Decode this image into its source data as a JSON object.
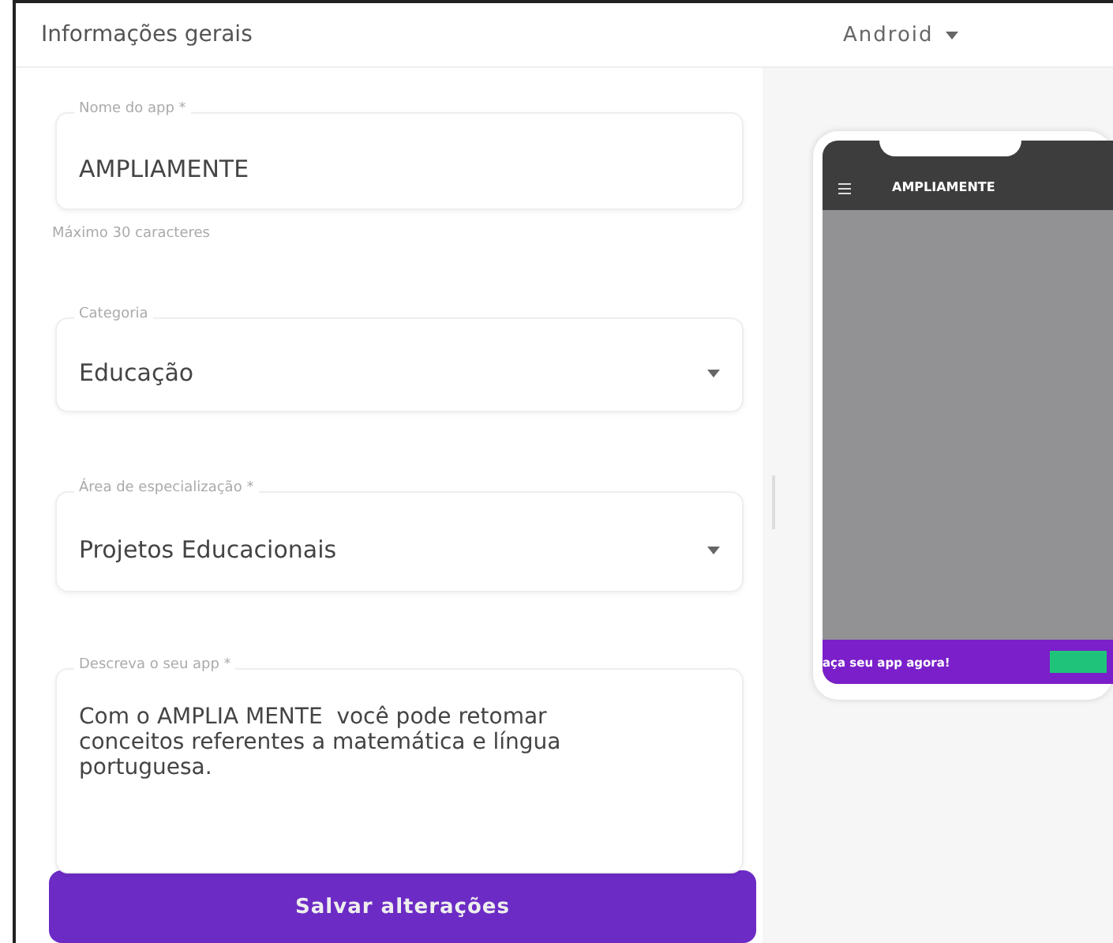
{
  "header": {
    "title": "Informações gerais",
    "platform": "Android"
  },
  "fields": [
    {
      "kind": "text",
      "label": "Nome do app *",
      "value": "AMPLIAMENTE",
      "hint": "Máximo 30 caracteres"
    },
    {
      "kind": "select",
      "label": "Categoria",
      "value": "Educação"
    },
    {
      "kind": "select",
      "label": "Área de especialização *",
      "value": "Projetos Educacionais"
    },
    {
      "kind": "textarea",
      "label": "Descreva o seu app *",
      "value": "Com o AMPLIA MENTE  você pode retomar conceitos referentes a matemática e língua portuguesa."
    }
  ],
  "save_button": "Salvar alterações",
  "preview": {
    "app_title": "AMPLIAMENTE",
    "banner_text": "aça seu app agora!"
  }
}
